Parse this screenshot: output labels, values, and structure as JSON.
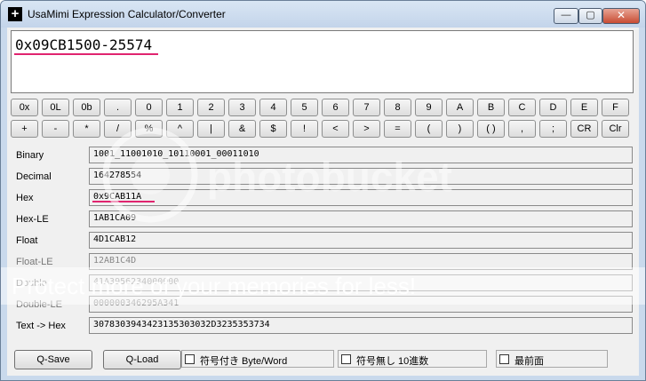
{
  "window": {
    "title": "UsaMimi Expression Calculator/Converter",
    "app_icon": "+",
    "controls": {
      "minimize": "—",
      "maximize": "▢",
      "close": "✕"
    }
  },
  "expression": {
    "value": "0x09CB1500-25574"
  },
  "keypad": {
    "row1": [
      "0x",
      "0L",
      "0b",
      ".",
      "0",
      "1",
      "2",
      "3",
      "4",
      "5",
      "6",
      "7",
      "8",
      "9",
      "A",
      "B",
      "C",
      "D",
      "E",
      "F"
    ],
    "row2": [
      "+",
      "-",
      "*",
      "/",
      "%",
      "^",
      "|",
      "&",
      "$",
      "!",
      "<",
      ">",
      "=",
      "(",
      ")",
      "( )",
      ",",
      ";",
      "CR",
      "Clr"
    ]
  },
  "fields": [
    {
      "label": "Binary",
      "value": "1001_11001010_10110001_00011010",
      "enabled": true
    },
    {
      "label": "Decimal",
      "value": "164278554",
      "enabled": true
    },
    {
      "label": "Hex",
      "value": "0x9CAB11A",
      "enabled": true
    },
    {
      "label": "Hex-LE",
      "value": "1AB1CA09",
      "enabled": true
    },
    {
      "label": "Float",
      "value": "4D1CAB12",
      "enabled": true
    },
    {
      "label": "Float-LE",
      "value": "12AB1C4D",
      "enabled": false
    },
    {
      "label": "Double",
      "value": "41A3956234000000",
      "enabled": false
    },
    {
      "label": "Double-LE",
      "value": "000000346295A341",
      "enabled": false
    },
    {
      "label": "Text -> Hex",
      "value": "3078303943423135303032D3235353734",
      "enabled": true
    }
  ],
  "bottom": {
    "qsave": "Q-Save",
    "qload": "Q-Load",
    "signed_checkbox": "符号付き Byte/Word",
    "unsigned_checkbox": "符号無し 10進数",
    "topmost_checkbox": "最前面"
  },
  "watermark": {
    "logo_text": "photobucket",
    "tagline": "Protect more of your memories for less!"
  },
  "colors": {
    "accent_underline": "#e0246f",
    "titlebar": "#c9d9ec",
    "close_button": "#c84b32"
  }
}
